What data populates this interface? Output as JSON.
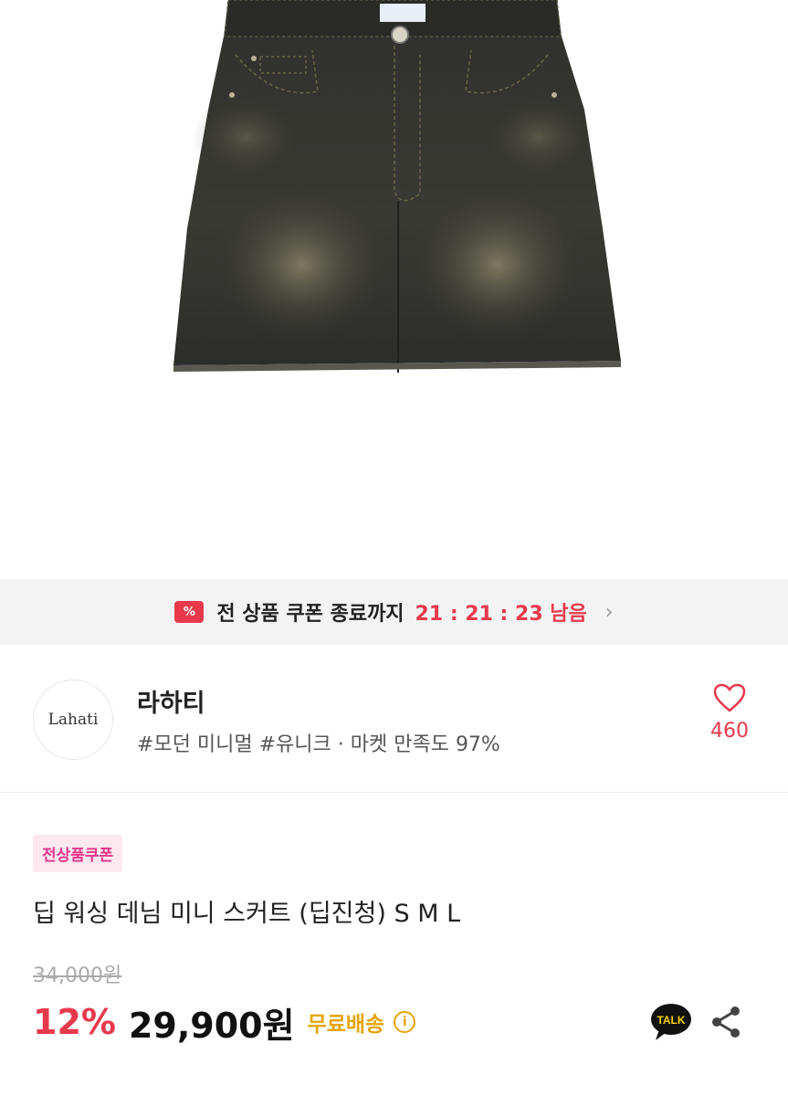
{
  "product_image": {
    "alt": "deep washing denim mini skirt"
  },
  "coupon_banner": {
    "icon_text": "%",
    "label": "전 상품 쿠폰 종료까지",
    "timer": "21 : 21 : 23 남음",
    "chevron": "›"
  },
  "store": {
    "logo_text": "Lahati",
    "name": "라하티",
    "tags": "#모던 미니멀 #유니크 · 마켓 만족도 97%",
    "like_count": "460"
  },
  "product": {
    "badge": "전상품쿠폰",
    "title": "딥 워싱 데님 미니 스커트 (딥진청) S M L",
    "original_price": "34,000원",
    "discount": "12%",
    "sale_price": "29,900원",
    "shipping": "무료배송",
    "info_icon": "i"
  },
  "actions": {
    "talk_label": "TALK"
  },
  "colors": {
    "accent": "#e8394c",
    "badge_bg": "#fde8f0",
    "badge_text": "#e5358a",
    "shipping": "#e6a400"
  }
}
